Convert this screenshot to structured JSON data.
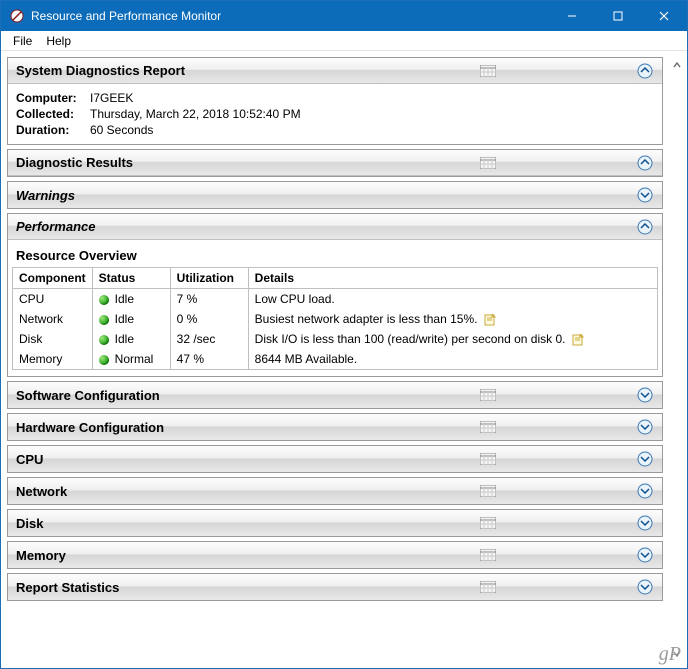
{
  "window": {
    "title": "Resource and Performance Monitor"
  },
  "menu": {
    "file": "File",
    "help": "Help"
  },
  "sections": {
    "sysdiag": {
      "title": "System Diagnostics Report",
      "expanded": true,
      "kv": {
        "computer_k": "Computer:",
        "computer_v": "I7GEEK",
        "collected_k": "Collected:",
        "collected_v": "Thursday, March 22, 2018 10:52:40 PM",
        "duration_k": "Duration:",
        "duration_v": "60 Seconds"
      }
    },
    "diag_results": {
      "title": "Diagnostic Results",
      "expanded": true
    },
    "warnings": {
      "title": "Warnings",
      "expanded": false
    },
    "performance": {
      "title": "Performance",
      "expanded": true
    },
    "resource_overview": {
      "title": "Resource Overview",
      "columns": {
        "component": "Component",
        "status": "Status",
        "utilization": "Utilization",
        "details": "Details"
      },
      "rows": [
        {
          "component": "CPU",
          "status": "Idle",
          "utilization": "7 %",
          "details": "Low CPU load.",
          "note": false
        },
        {
          "component": "Network",
          "status": "Idle",
          "utilization": "0 %",
          "details": "Busiest network adapter is less than 15%.",
          "note": true
        },
        {
          "component": "Disk",
          "status": "Idle",
          "utilization": "32 /sec",
          "details": "Disk I/O is less than 100 (read/write) per second on disk 0.",
          "note": true
        },
        {
          "component": "Memory",
          "status": "Normal",
          "utilization": "47 %",
          "details": "8644 MB Available.",
          "note": false
        }
      ]
    },
    "software_conf": {
      "title": "Software Configuration",
      "expanded": false
    },
    "hardware_conf": {
      "title": "Hardware Configuration",
      "expanded": false
    },
    "cpu": {
      "title": "CPU",
      "expanded": false
    },
    "network": {
      "title": "Network",
      "expanded": false
    },
    "disk": {
      "title": "Disk",
      "expanded": false
    },
    "memory": {
      "title": "Memory",
      "expanded": false
    },
    "report_stats": {
      "title": "Report Statistics",
      "expanded": false
    }
  },
  "watermark": "gP"
}
